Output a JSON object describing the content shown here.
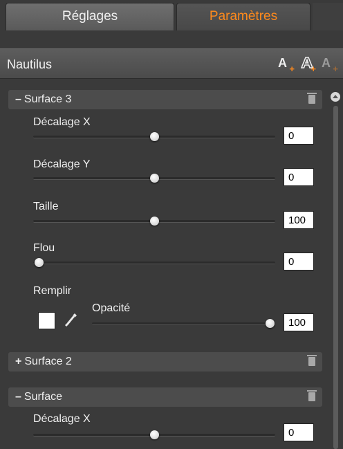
{
  "tabs": [
    {
      "label": "Réglages",
      "active": false
    },
    {
      "label": "Paramètres",
      "active": true
    }
  ],
  "panel": {
    "title": "Nautilus",
    "icons": [
      "add-text-icon",
      "add-outline-text-icon",
      "add-effect-icon"
    ]
  },
  "sections": [
    {
      "name": "Surface 3",
      "expanded": true,
      "controls": [
        {
          "label": "Décalage X",
          "value": "0",
          "level": 0.5
        },
        {
          "label": "Décalage Y",
          "value": "0",
          "level": 0.5
        },
        {
          "label": "Taille",
          "value": "100",
          "level": 0.5
        },
        {
          "label": "Flou",
          "value": "0",
          "level": 0.0
        }
      ],
      "fill": {
        "label": "Remplir",
        "swatch_color": "#ffffff",
        "opacity_label": "Opacité",
        "opacity_value": "100",
        "opacity_level": 1.0
      }
    },
    {
      "name": "Surface 2",
      "expanded": false
    },
    {
      "name": "Surface",
      "expanded": true,
      "controls": [
        {
          "label": "Décalage X",
          "value": "0",
          "level": 0.5
        }
      ]
    }
  ],
  "signs": {
    "expanded": "–",
    "collapsed": "+"
  },
  "colors": {
    "accent": "#ff8a1c",
    "panel_bg": "#3a3a3a",
    "section_bg": "#4c4c4c"
  }
}
